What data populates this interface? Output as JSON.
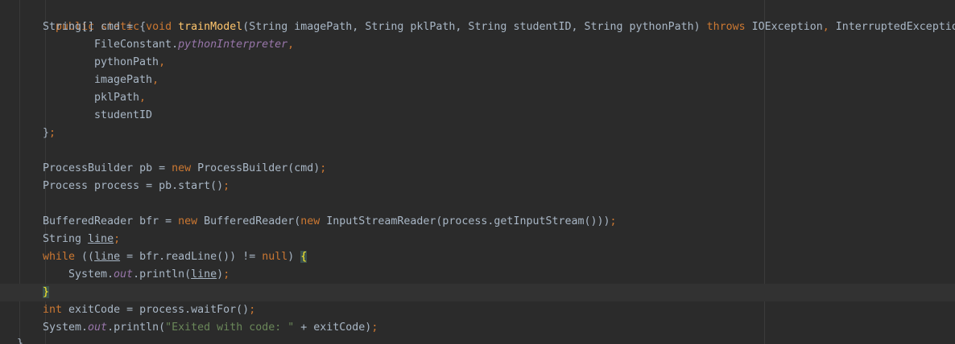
{
  "code": {
    "l1": {
      "kw1": "public static void ",
      "fn": "trainModel",
      "t1": "(String imagePath, String pklPath, String studentID, String pythonPath) ",
      "kw2": "throws ",
      "t2": "IOException",
      "p1": ", ",
      "t3": "InterruptedException {"
    },
    "l2": {
      "t1": "String[] cmd = {"
    },
    "l3": {
      "t1": "FileConstant.",
      "field": "pythonInterpreter",
      "p1": ","
    },
    "l4": {
      "t1": "pythonPath",
      "p1": ","
    },
    "l5": {
      "t1": "imagePath",
      "p1": ","
    },
    "l6": {
      "t1": "pklPath",
      "p1": ","
    },
    "l7": {
      "t1": "studentID"
    },
    "l8": {
      "t1": "}",
      "p1": ";"
    },
    "l10": {
      "t1": "ProcessBuilder pb = ",
      "kw1": "new ",
      "t2": "ProcessBuilder(cmd)",
      "p1": ";"
    },
    "l11": {
      "t1": "Process process = pb.start()",
      "p1": ";"
    },
    "l13": {
      "t1": "BufferedReader bfr = ",
      "kw1": "new ",
      "t2": "BufferedReader(",
      "kw2": "new ",
      "t3": "InputStreamReader(process.getInputStream()))",
      "p1": ";"
    },
    "l14": {
      "t1": "String ",
      "var": "line",
      "p1": ";"
    },
    "l15": {
      "kw1": "while ",
      "t1": "((",
      "var": "line",
      "t2": " = bfr.readLine()) != ",
      "kw2": "null",
      "t3": ") ",
      "brace": "{"
    },
    "l16": {
      "t1": "System.",
      "field": "out",
      "t2": ".println(",
      "var": "line",
      "t3": ")",
      "p1": ";"
    },
    "l17": {
      "brace": "}"
    },
    "l18": {
      "kw1": "int ",
      "t1": "exitCode = process.waitFor()",
      "p1": ";"
    },
    "l19": {
      "t1": "System.",
      "field": "out",
      "t2": ".println(",
      "str": "\"Exited with code: \"",
      "t3": " + exitCode)",
      "p1": ";"
    },
    "l20": {
      "t1": "}"
    }
  }
}
